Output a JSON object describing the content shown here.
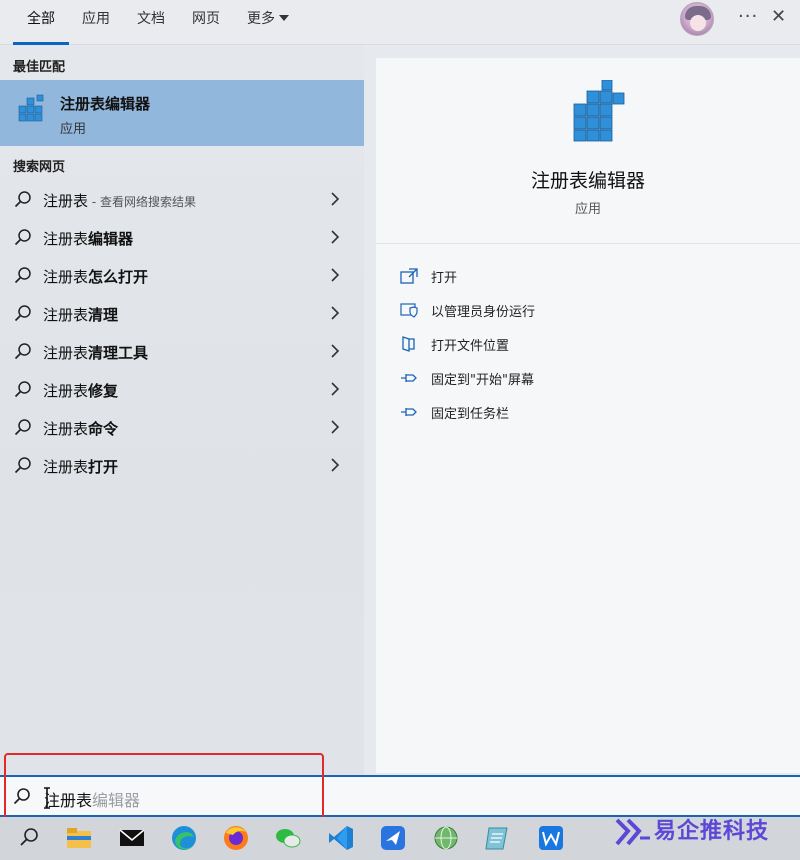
{
  "tabs": [
    {
      "label": "全部",
      "active": true
    },
    {
      "label": "应用",
      "active": false
    },
    {
      "label": "文档",
      "active": false
    },
    {
      "label": "网页",
      "active": false
    },
    {
      "label": "更多",
      "active": false
    }
  ],
  "window_controls": {
    "more": "···",
    "close": "✕"
  },
  "left": {
    "best_match_heading": "最佳匹配",
    "best_match": {
      "name": "注册表编辑器",
      "type": "应用"
    },
    "web_heading": "搜索网页",
    "results": [
      {
        "prefix": "注册表",
        "bold": "",
        "sub": " - 查看网络搜索结果"
      },
      {
        "prefix": "注册表",
        "bold": "编辑器",
        "sub": ""
      },
      {
        "prefix": "注册表",
        "bold": "怎么打开",
        "sub": ""
      },
      {
        "prefix": "注册表",
        "bold": "清理",
        "sub": ""
      },
      {
        "prefix": "注册表",
        "bold": "清理工具",
        "sub": ""
      },
      {
        "prefix": "注册表",
        "bold": "修复",
        "sub": ""
      },
      {
        "prefix": "注册表",
        "bold": "命令",
        "sub": ""
      },
      {
        "prefix": "注册表",
        "bold": "打开",
        "sub": ""
      }
    ]
  },
  "right": {
    "title": "注册表编辑器",
    "subtitle": "应用",
    "actions": [
      {
        "label": "打开",
        "icon": "open-icon"
      },
      {
        "label": "以管理员身份运行",
        "icon": "shield-icon"
      },
      {
        "label": "打开文件位置",
        "icon": "file-location-icon"
      },
      {
        "label": "固定到\"开始\"屏幕",
        "icon": "pin-icon"
      },
      {
        "label": "固定到任务栏",
        "icon": "pin-icon"
      }
    ]
  },
  "search": {
    "typed": "注册表",
    "suggestion": "编辑器"
  },
  "taskbar": {
    "items": [
      "search-icon",
      "file-explorer-icon",
      "mail-icon",
      "edge-icon",
      "firefox-icon",
      "wechat-icon",
      "vscode-icon",
      "feishu-icon",
      "globe-icon",
      "notes-icon",
      "wps-icon"
    ]
  },
  "watermark": {
    "text": "易企推科技"
  },
  "colors": {
    "accent": "#0a66c2",
    "best_match_bg": "#92b7dc",
    "highlight_box": "#e22a2a",
    "watermark": "#5b48d6"
  }
}
